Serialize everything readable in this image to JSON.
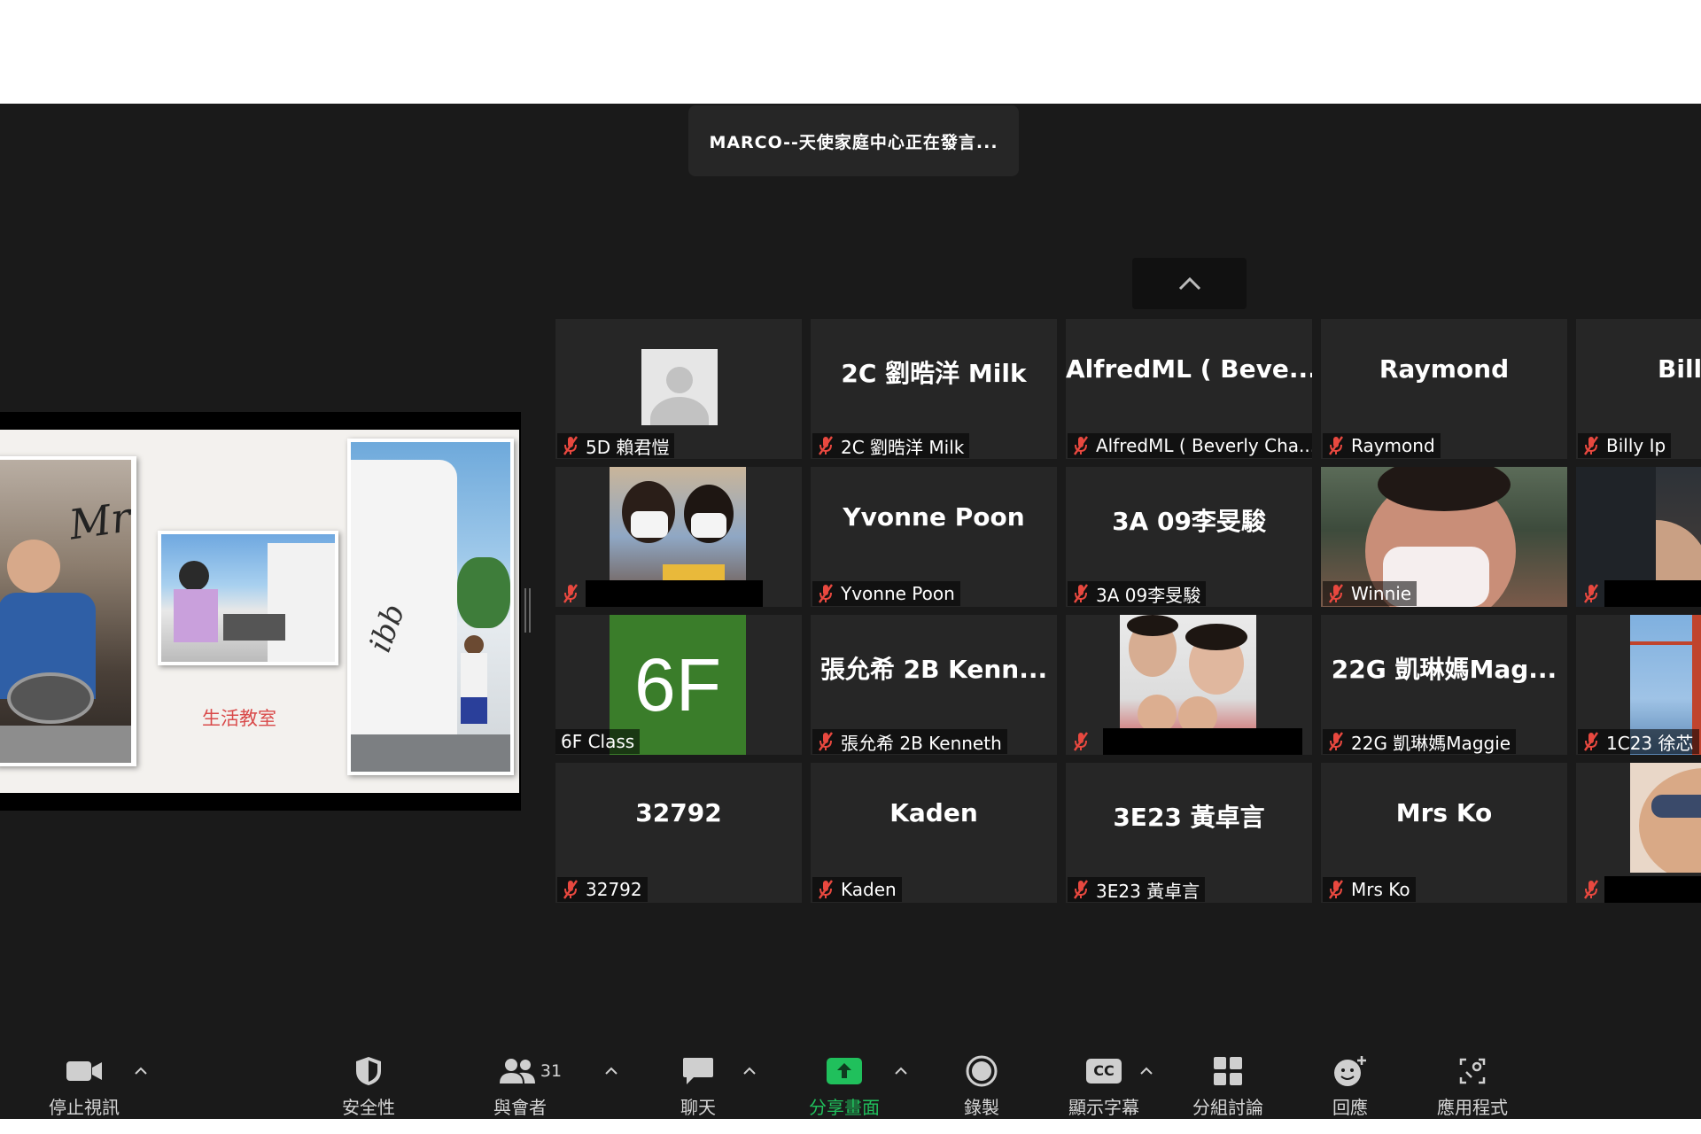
{
  "speaker_banner": "MARCO--天使家庭中心正在發言...",
  "share": {
    "slide_caption": "生活教室",
    "slide_handwriting_1": "Mrk",
    "slide_handwriting_2": "ibb"
  },
  "tiles": [
    {
      "big": "",
      "name": "5D 賴君愷",
      "type": "avatar"
    },
    {
      "big": "2C 劉晧洋 Milk",
      "name": "2C 劉晧洋 Milk"
    },
    {
      "big": "AlfredML ( Beve...",
      "name": "AlfredML ( Beverly Cha..."
    },
    {
      "big": "Raymond",
      "name": "Raymond"
    },
    {
      "big": "Billy",
      "name": "Billy Ip"
    },
    {
      "big": "",
      "name": "",
      "type": "video"
    },
    {
      "big": "Yvonne Poon",
      "name": "Yvonne Poon"
    },
    {
      "big": "3A 09李旻駿",
      "name": "3A 09李旻駿"
    },
    {
      "big": "",
      "name": "Winnie",
      "type": "video"
    },
    {
      "big": "",
      "name": "",
      "type": "video"
    },
    {
      "big": "6F",
      "name": "6F Class",
      "type": "logo"
    },
    {
      "big": "張允希 2B Kenn...",
      "name": "張允希 2B Kenneth"
    },
    {
      "big": "",
      "name": "",
      "type": "video"
    },
    {
      "big": "22G 凱琳媽Mag...",
      "name": "22G 凱琳媽Maggie"
    },
    {
      "big": "",
      "name": "1C23 徐芯",
      "type": "video"
    },
    {
      "big": "32792",
      "name": "32792"
    },
    {
      "big": "Kaden",
      "name": "Kaden"
    },
    {
      "big": "3E23 黃卓言",
      "name": "3E23 黃卓言"
    },
    {
      "big": "Mrs Ko",
      "name": "Mrs Ko"
    },
    {
      "big": "",
      "name": "",
      "type": "video"
    }
  ],
  "toolbar": {
    "video": "停止視訊",
    "security": "安全性",
    "participants": "與會者",
    "participants_count": "31",
    "chat": "聊天",
    "share": "分享畫面",
    "record": "錄製",
    "captions": "顯示字幕",
    "captions_icon": "CC",
    "breakout": "分組討論",
    "reactions": "回應",
    "apps": "應用程式"
  },
  "colors": {
    "background": "#1a1a1a",
    "tile": "#262626",
    "share_green": "#20c05c",
    "muted_red": "#e8483f",
    "logo_green": "#3a7d2a"
  },
  "icons": [
    "video-icon",
    "shield-icon",
    "participants-icon",
    "chat-icon",
    "share-screen-icon",
    "record-icon",
    "cc-icon",
    "breakout-icon",
    "reaction-icon",
    "apps-icon",
    "mic-muted-icon",
    "chevron-up-icon"
  ]
}
